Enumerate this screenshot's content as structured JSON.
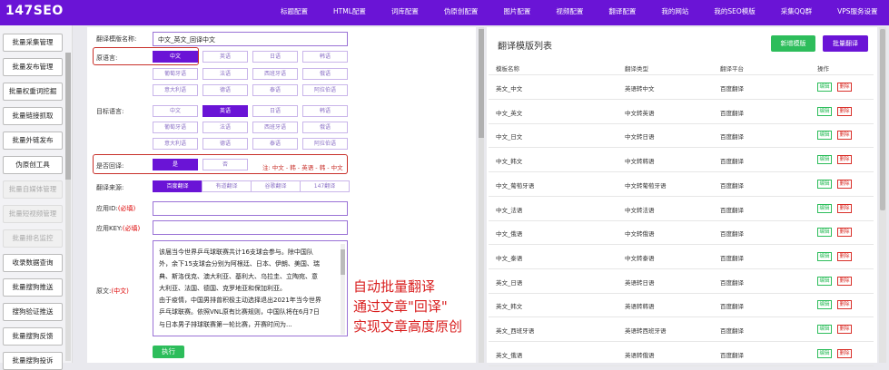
{
  "header": {
    "logo": "147SEO",
    "nav": [
      "标题配置",
      "HTML配置",
      "词库配置",
      "伪原创配置",
      "图片配置",
      "视频配置",
      "翻译配置",
      "我的网站",
      "我的SEO模版",
      "采集QQ群",
      "VPS服务设置"
    ]
  },
  "sidebar": {
    "items": [
      {
        "label": "批量采集管理",
        "enabled": true
      },
      {
        "label": "批量发布管理",
        "enabled": true
      },
      {
        "label": "批量权重词挖掘",
        "enabled": true
      },
      {
        "label": "批量链接抓取",
        "enabled": true
      },
      {
        "label": "批量外链发布",
        "enabled": true
      },
      {
        "label": "伪原创工具",
        "enabled": true
      },
      {
        "label": "批量自媒体管理",
        "enabled": false
      },
      {
        "label": "批量短视频管理",
        "enabled": false
      },
      {
        "label": "批量排名监控",
        "enabled": false
      },
      {
        "label": "收录数据查询",
        "enabled": true
      },
      {
        "label": "批量搜狗推送",
        "enabled": true
      },
      {
        "label": "搜狗验证推送",
        "enabled": true
      },
      {
        "label": "批量搜狗反馈",
        "enabled": true
      },
      {
        "label": "批量搜狗投诉",
        "enabled": true
      }
    ]
  },
  "form": {
    "template_name_label": "翻译模版名称:",
    "template_name_value": "中文_英文_回译中文",
    "source_lang_label": "原语言:",
    "target_lang_label": "目标语言:",
    "languages_row1": [
      "中文",
      "英语",
      "日语",
      "韩语"
    ],
    "languages_row2": [
      "葡萄牙语",
      "法语",
      "西班牙语",
      "俄语"
    ],
    "languages_row3": [
      "意大利语",
      "德语",
      "泰语",
      "阿拉伯语"
    ],
    "source_selected": "中文",
    "target_selected": "英语",
    "backtranslate_label": "是否回译:",
    "backtranslate_yes": "是",
    "backtranslate_no": "否",
    "backtranslate_note": "注: 中文 - 韩 - 英语 - 韩 - 中文",
    "source_label": "翻译来源:",
    "sources": [
      "百度翻译",
      "有道翻译",
      "谷歌翻译",
      "147翻译"
    ],
    "appid_label": "应用ID:",
    "appid_required": "(必填)",
    "appkey_label": "应用KEY:",
    "appkey_required": "(必填)",
    "original_label": "原文:",
    "original_hint": "(中文)",
    "original_lines": [
      "该届当今世界乒乓球联赛共计16支球会参与。除中国队",
      "外，余下15支球会分别为阿根廷、日本、伊朗、美国、瑞",
      "典、斯洛伐克、澳大利亚、基利大、乌拉圭、立陶宛、意",
      "大利亚、法国、德国、克罗地亚和保加利亚。",
      "由于疫情，中国男排曾积极主动选择退出2021年当今世界",
      "乒乓球联赛。依照VNL原有比赛规则，中国队将在6月7日",
      "与日本男子排球联赛第一轮比赛，开赛时间为..."
    ],
    "execute_label": "执行"
  },
  "annotation": {
    "lines": [
      "自动批量翻译",
      "通过文章\"回译\"",
      "实现文章高度原创"
    ],
    "color": "#d91f1f"
  },
  "list": {
    "title": "翻译模版列表",
    "new_button": "新增模版",
    "batch_button": "批量翻译",
    "columns": [
      "模板名称",
      "翻译类型",
      "翻译平台",
      "操作"
    ],
    "edit_label": "编辑",
    "delete_label": "删除",
    "rows": [
      {
        "name": "英文_中文",
        "type": "英语转中文",
        "platform": "百度翻译"
      },
      {
        "name": "中文_英文",
        "type": "中文转英语",
        "platform": "百度翻译"
      },
      {
        "name": "中文_日文",
        "type": "中文转日语",
        "platform": "百度翻译"
      },
      {
        "name": "中文_韩文",
        "type": "中文转韩语",
        "platform": "百度翻译"
      },
      {
        "name": "中文_葡萄牙语",
        "type": "中文转葡萄牙语",
        "platform": "百度翻译"
      },
      {
        "name": "中文_法语",
        "type": "中文转法语",
        "platform": "百度翻译"
      },
      {
        "name": "中文_俄语",
        "type": "中文转俄语",
        "platform": "百度翻译"
      },
      {
        "name": "中文_泰语",
        "type": "中文转泰语",
        "platform": "百度翻译"
      },
      {
        "name": "英文_日语",
        "type": "英语转日语",
        "platform": "百度翻译"
      },
      {
        "name": "英文_韩文",
        "type": "英语转韩语",
        "platform": "百度翻译"
      },
      {
        "name": "英文_西班牙语",
        "type": "英语转西班牙语",
        "platform": "百度翻译"
      },
      {
        "name": "英文_俄语",
        "type": "英语转俄语",
        "platform": "百度翻译"
      }
    ]
  },
  "colors": {
    "brand": "#6a14d6",
    "success": "#2dbd5b",
    "danger": "#d9302a"
  }
}
